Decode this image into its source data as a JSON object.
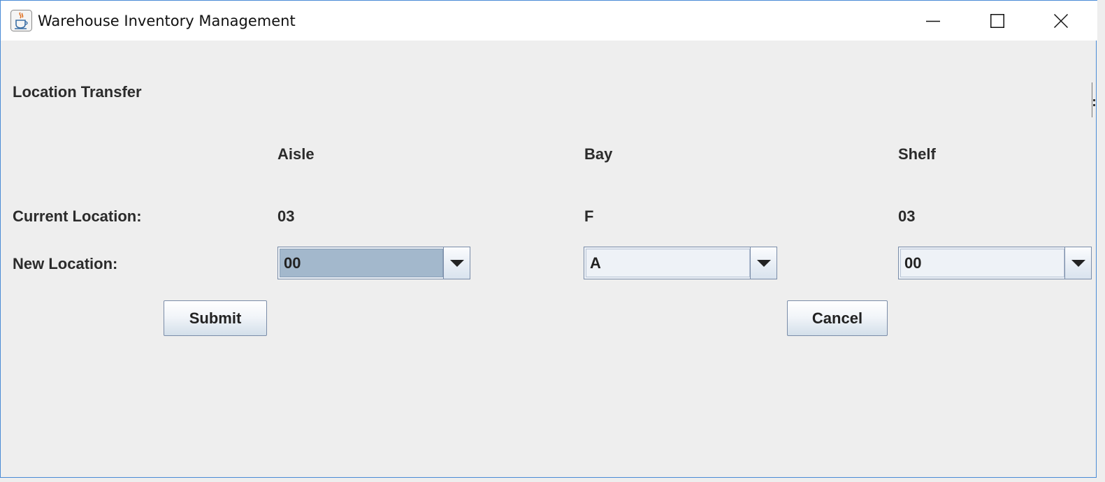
{
  "window": {
    "title": "Warehouse Inventory Management",
    "icon": "java-cup-icon"
  },
  "controls": {
    "minimize_icon": "minimize-icon",
    "maximize_icon": "maximize-icon",
    "close_icon": "close-icon"
  },
  "form": {
    "heading": "Location Transfer",
    "columns": {
      "aisle": "Aisle",
      "bay": "Bay",
      "shelf": "Shelf"
    },
    "current": {
      "label": "Current Location:",
      "aisle": "03",
      "bay": "F",
      "shelf": "03"
    },
    "new": {
      "label": "New Location:",
      "aisle": "00",
      "bay": "A",
      "shelf": "00"
    },
    "submit_label": "Submit",
    "cancel_label": "Cancel"
  },
  "colors": {
    "background": "#eeeeee",
    "titlebar": "#ffffff",
    "selection": "#a3b8cc",
    "window_border": "#4a8bd6"
  }
}
